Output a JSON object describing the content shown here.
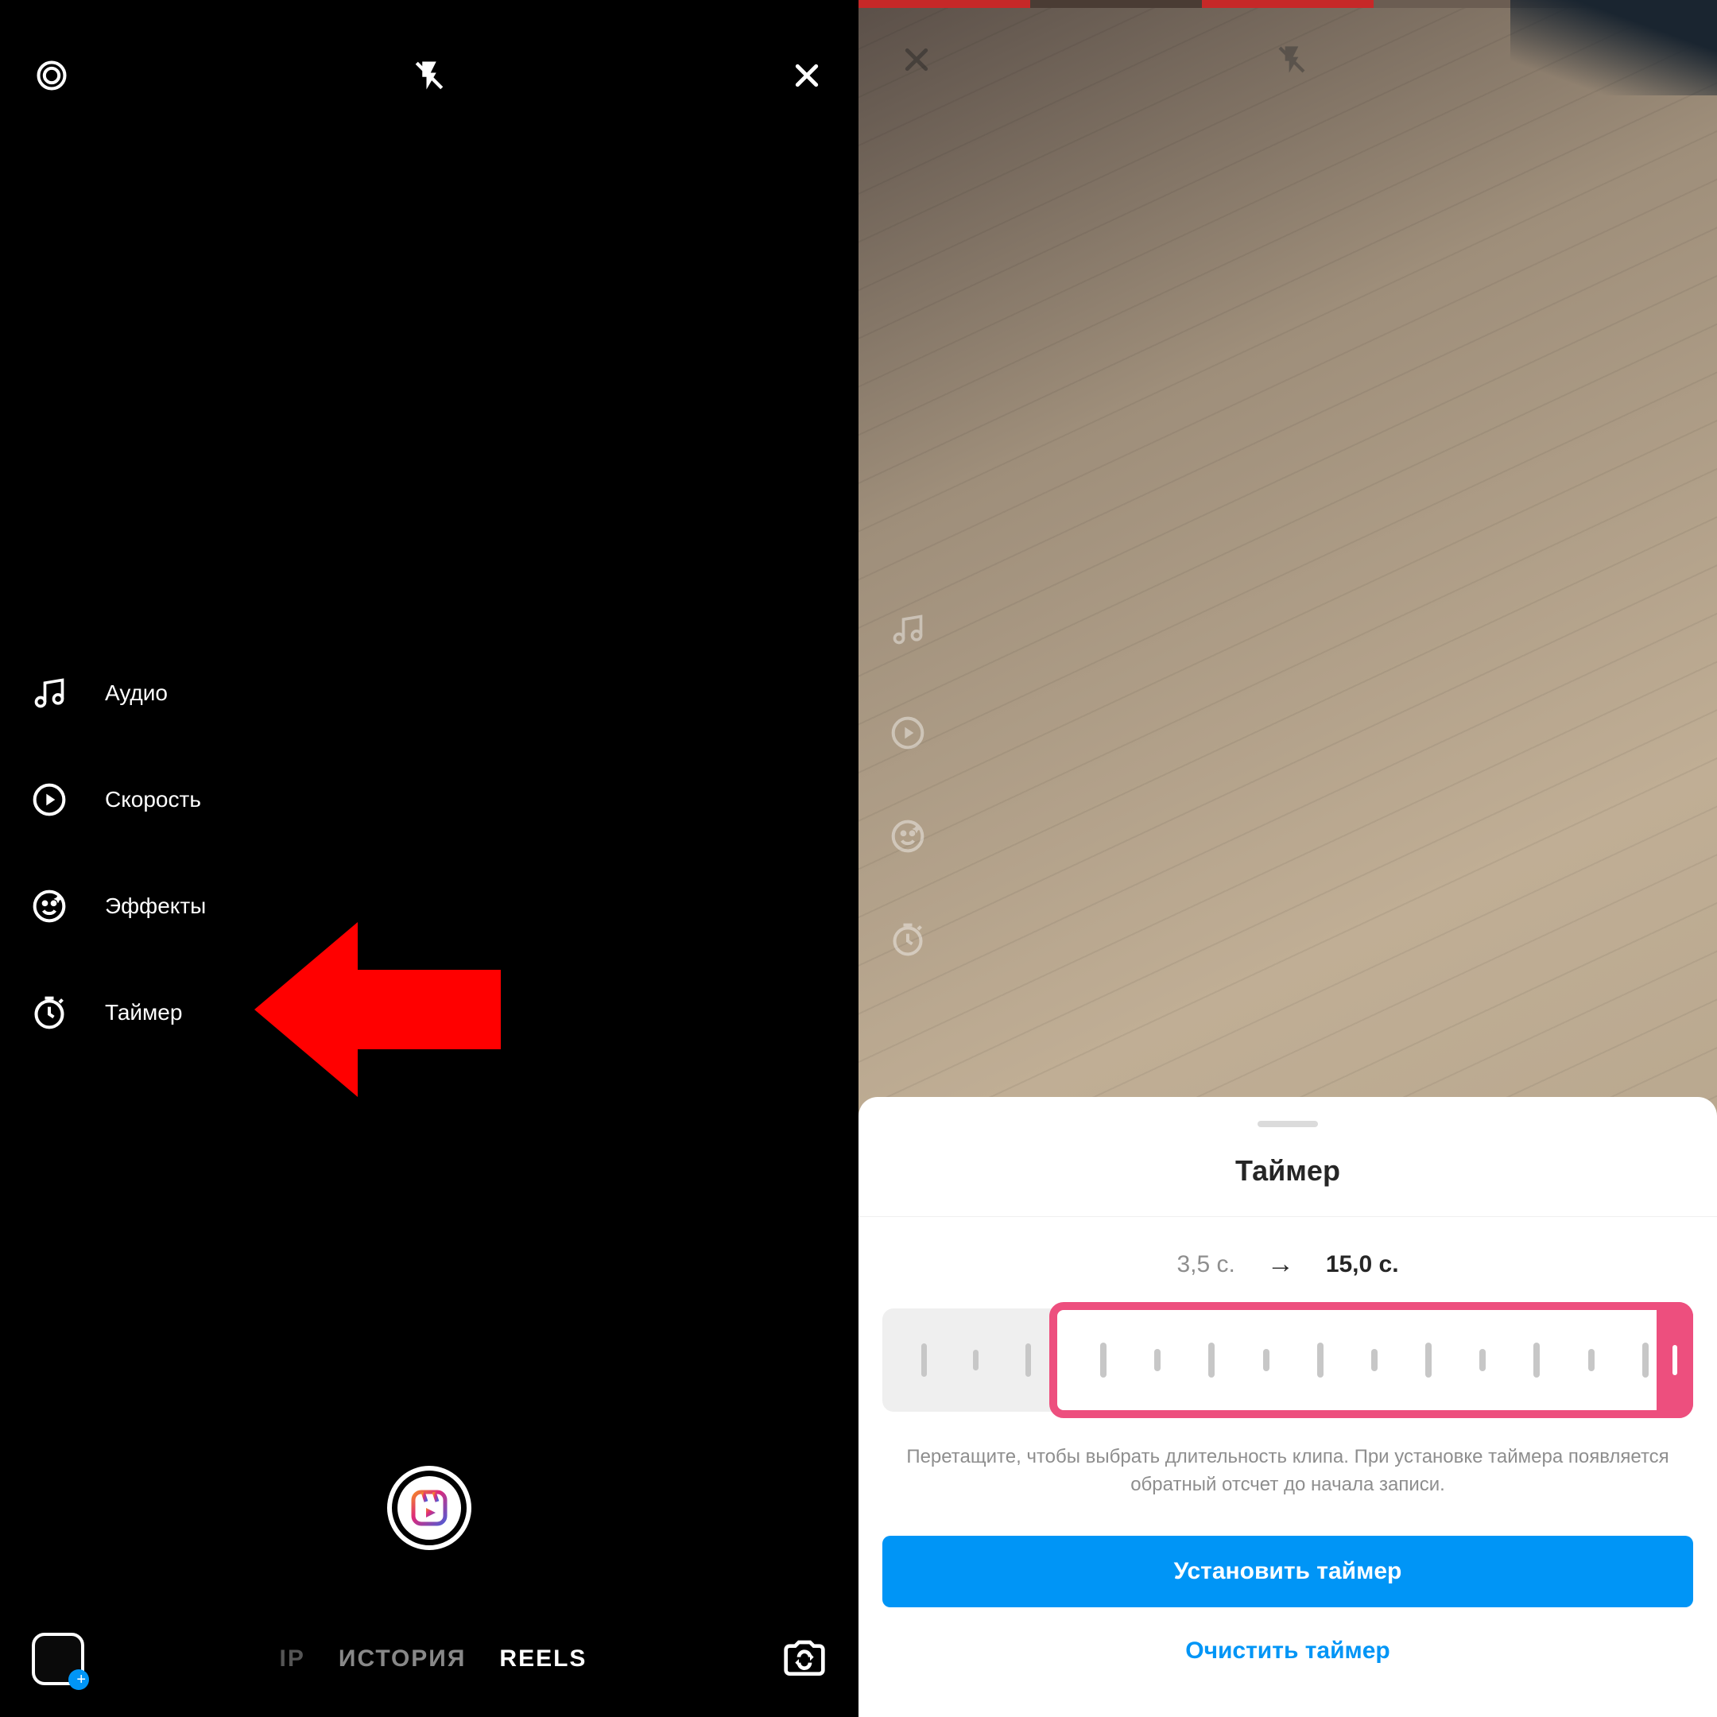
{
  "left": {
    "sideMenu": {
      "audio": "Аудио",
      "speed": "Скорость",
      "effects": "Эффекты",
      "timer": "Таймер"
    },
    "modes": {
      "clip": "IP",
      "story": "ИСТОРИЯ",
      "reels": "REELS"
    }
  },
  "right": {
    "sheet": {
      "title": "Таймер",
      "from": "3,5 с.",
      "to": "15,0 с.",
      "hint": "Перетащите, чтобы выбрать длительность клипа. При установке таймера появляется обратный отсчет до начала записи.",
      "primary": "Установить таймер",
      "clear": "Очистить таймер"
    }
  }
}
